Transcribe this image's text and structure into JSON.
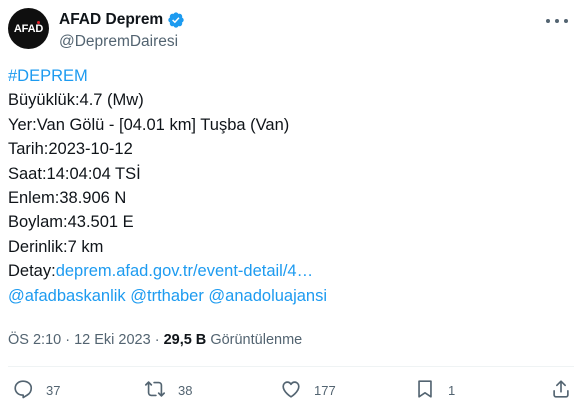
{
  "author": {
    "avatar_text": "AFAD",
    "display_name": "AFAD Deprem",
    "handle": "@DepremDairesi"
  },
  "tweet": {
    "hashtag": "#DEPREM",
    "magnitude": "Büyüklük:4.7 (Mw)",
    "location": "Yer:Van Gölü - [04.01 km] Tuşba (Van)",
    "date": "Tarih:2023-10-12",
    "time": "Saat:14:04:04 TSİ",
    "latitude": "Enlem:38.906 N",
    "longitude": "Boylam:43.501 E",
    "depth": "Derinlik:7 km",
    "detail_label": "Detay:",
    "detail_link": "deprem.afad.gov.tr/event-detail/4…",
    "mentions": "@afadbaskanlik @trthaber @anadoluajansi"
  },
  "meta": {
    "timestamp": "ÖS 2:10 · 12 Eki 2023 · ",
    "views_count": "29,5 B",
    "views_label": " Görüntülenme"
  },
  "actions": {
    "replies": "37",
    "reposts": "38",
    "likes": "177",
    "bookmarks": "1"
  },
  "colors": {
    "link": "#1d9bf0",
    "secondary_text": "#536471",
    "primary_text": "#0f1419",
    "verified": "#1d9bf0"
  }
}
